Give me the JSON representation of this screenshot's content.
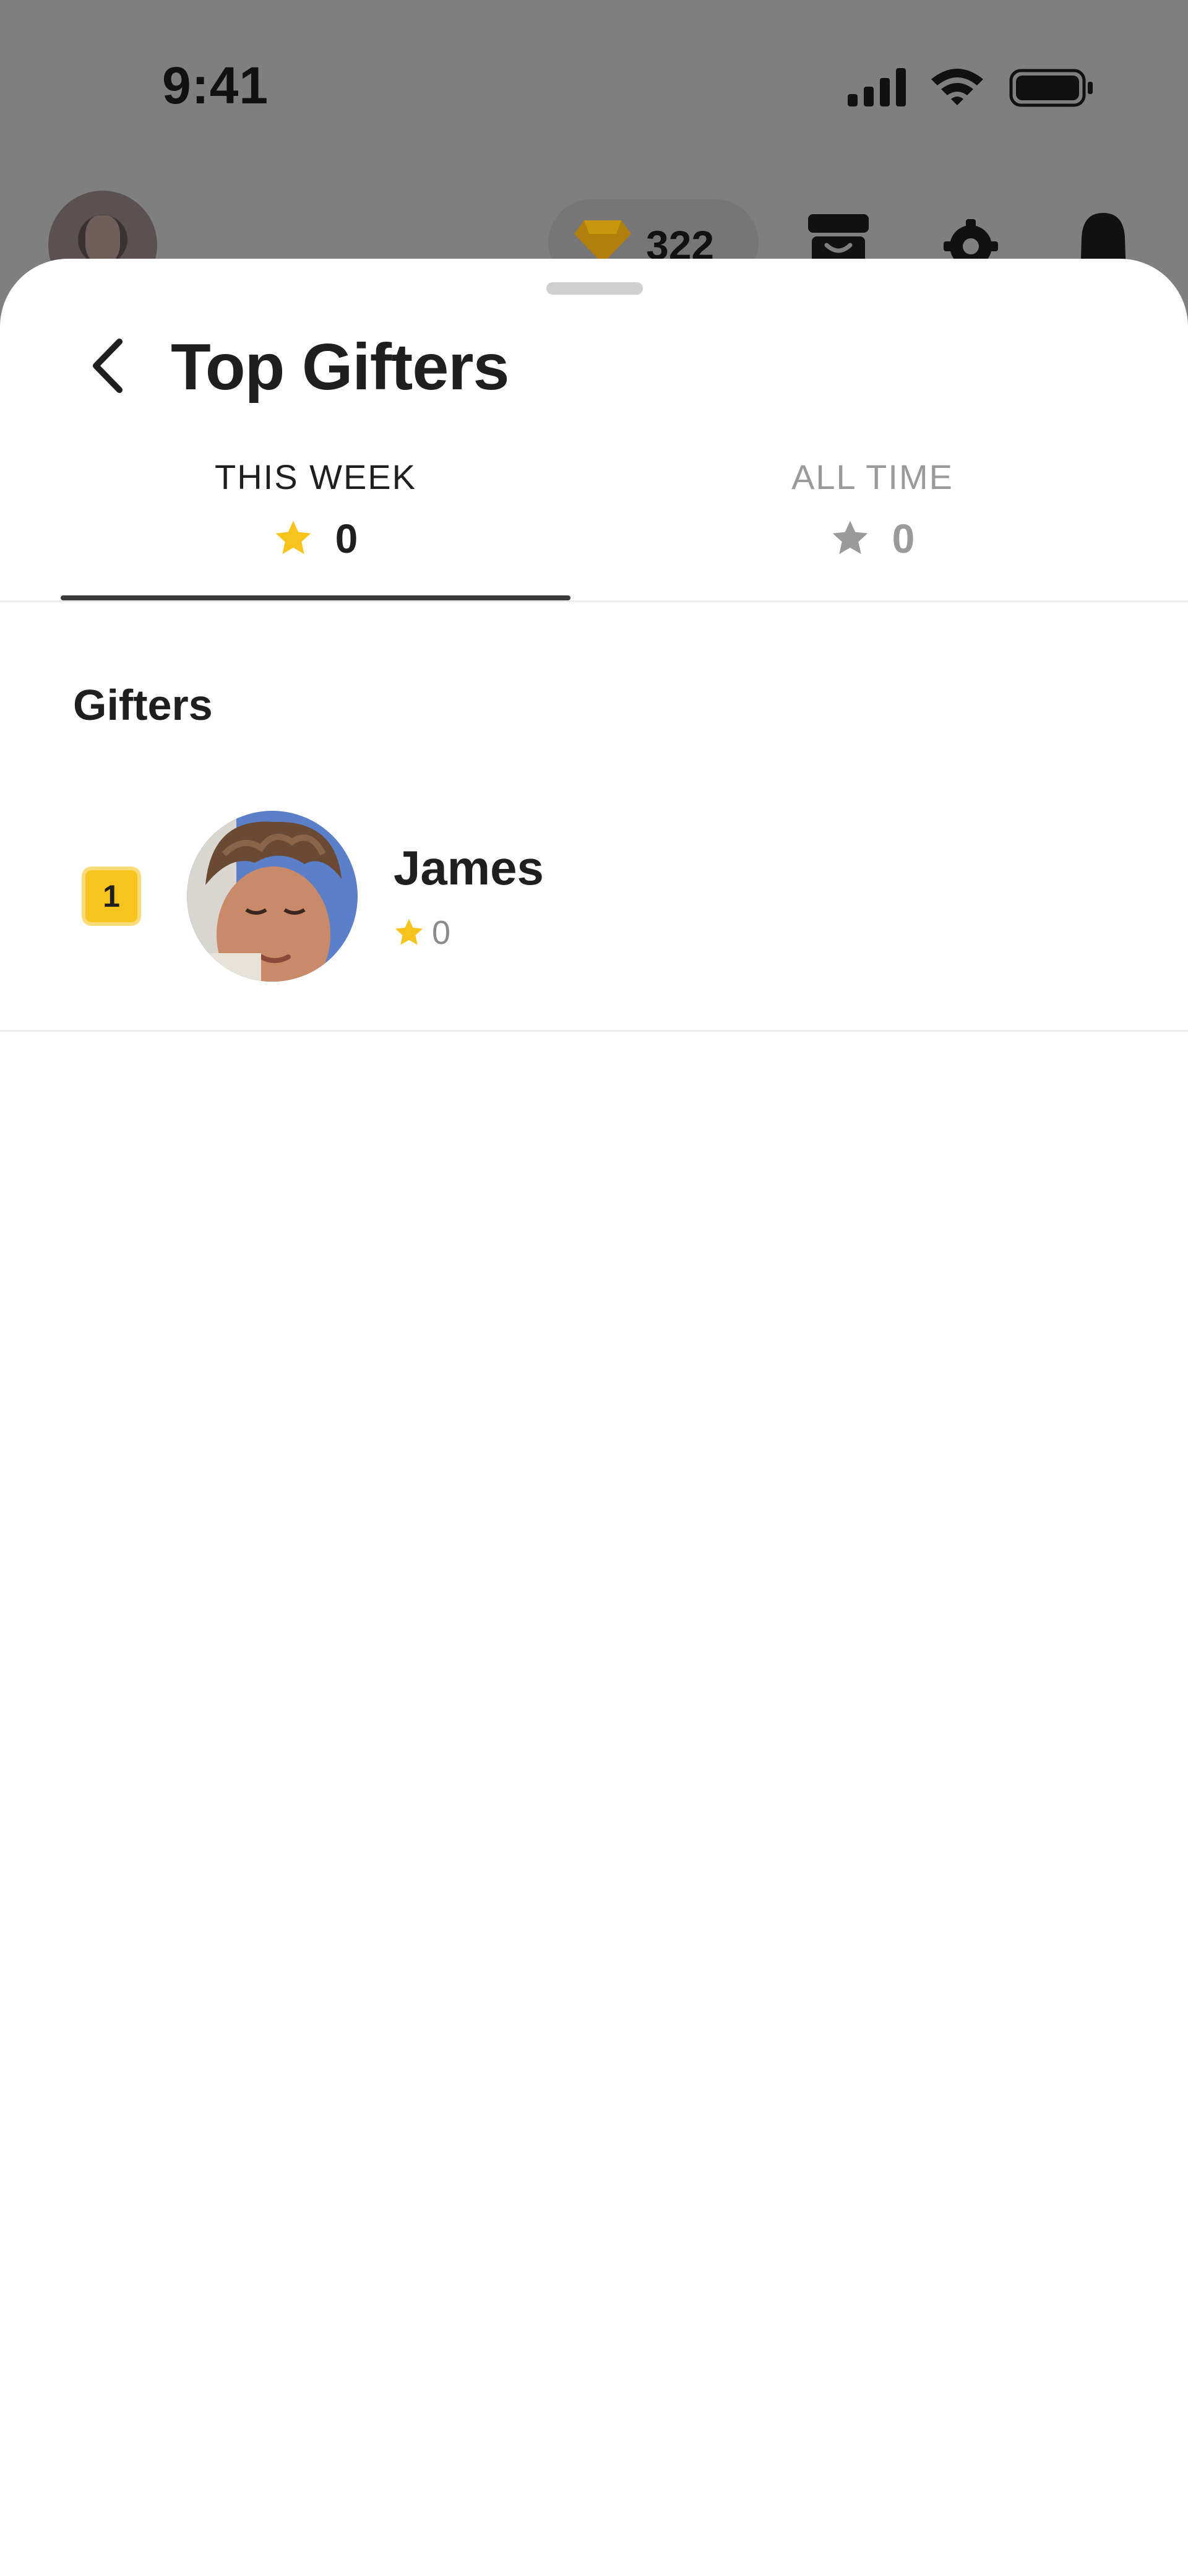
{
  "status_bar": {
    "time": "9:41",
    "icons": [
      "signal-icon",
      "wifi-icon",
      "battery-icon"
    ]
  },
  "background_header": {
    "avatar": "profile-avatar",
    "gem_count": "322",
    "icons": [
      "gem-icon",
      "archive-icon",
      "gear-icon",
      "bell-icon"
    ]
  },
  "sheet": {
    "title": "Top Gifters",
    "back_icon": "chevron-left-icon"
  },
  "tabs": [
    {
      "label": "THIS WEEK",
      "count": "0",
      "active": true,
      "icon": "star-icon",
      "icon_color": "#F6C41C"
    },
    {
      "label": "ALL TIME",
      "count": "0",
      "active": false,
      "icon": "star-icon",
      "icon_color": "#9A9A9A"
    }
  ],
  "list": {
    "heading": "Gifters",
    "rows": [
      {
        "rank": "1",
        "name": "James",
        "score": "0",
        "avatar": "user-avatar"
      }
    ]
  },
  "colors": {
    "accent_yellow": "#F6C41C",
    "text_primary": "#1F1F1F",
    "text_secondary": "#9A9A9A",
    "overlay": "#7F7F7F"
  }
}
